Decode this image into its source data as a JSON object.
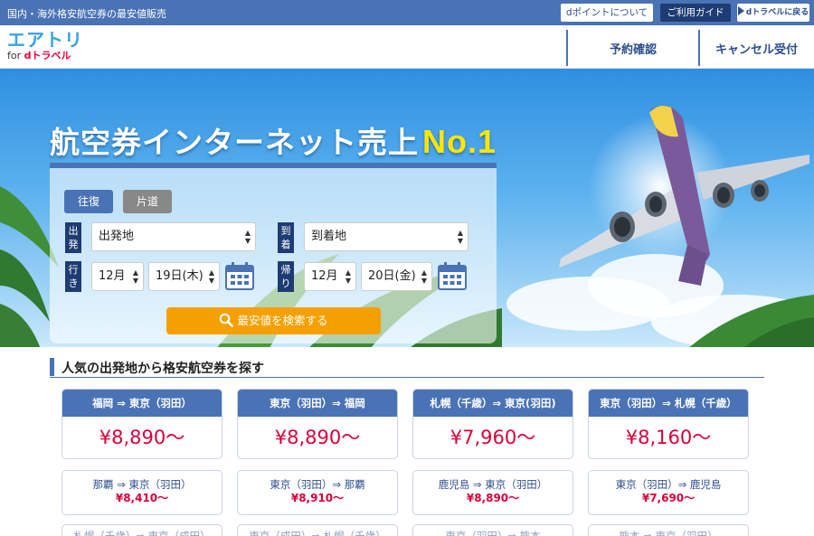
{
  "topbar": {
    "tagline": "国内・海外格安航空券の最安値販売",
    "dpoint": "dポイントについて",
    "guide": "ご利用ガイド",
    "back": "dトラベルに戻る"
  },
  "header": {
    "logo_main": "エアトリ",
    "logo_for": "for ",
    "logo_brand": "dトラベル",
    "nav": [
      "予約確認",
      "キャンセル受付"
    ]
  },
  "hero": {
    "title": "航空券インターネット売上",
    "title_badge": "No.1"
  },
  "search": {
    "tabs": [
      "往復",
      "片道"
    ],
    "depart_label": "出発",
    "arrive_label": "到着",
    "outbound_label": "行き",
    "return_label": "帰り",
    "depart_value": "出発地",
    "arrive_value": "到着地",
    "outbound_month": "12月",
    "outbound_day": "19日(木)",
    "return_month": "12月",
    "return_day": "20日(金)",
    "button": "最安値を検索する"
  },
  "section": {
    "title": "人気の出発地から格安航空券を探す"
  },
  "featured_routes": [
    {
      "route": "福岡 ⇒ 東京（羽田）",
      "price": "¥8,890〜"
    },
    {
      "route": "東京（羽田）⇒ 福岡",
      "price": "¥8,890〜"
    },
    {
      "route": "札幌（千歳）⇒ 東京(羽田)",
      "price": "¥7,960〜"
    },
    {
      "route": "東京（羽田）⇒ 札幌（千歳）",
      "price": "¥8,160〜"
    }
  ],
  "more_routes": [
    {
      "route": "那覇 ⇒ 東京（羽田）",
      "price": "¥8,410〜"
    },
    {
      "route": "東京（羽田）⇒ 那覇",
      "price": "¥8,910〜"
    },
    {
      "route": "鹿児島 ⇒ 東京（羽田）",
      "price": "¥8,890〜"
    },
    {
      "route": "東京（羽田）⇒ 鹿児島",
      "price": "¥7,690〜"
    }
  ],
  "partial_routes": [
    "札幌（千歳）⇒ 東京（成田）",
    "東京（成田）⇒ 札幌（千歳）",
    "東京（羽田）⇒ 熊本",
    "熊本 ⇒ 東京（羽田）"
  ],
  "colors": {
    "primary": "#4a73b5",
    "dark_navy": "#1e3c73",
    "price_red": "#d9003a",
    "search_orange": "#f5a000",
    "brand_cyan": "#3aa0e0"
  }
}
